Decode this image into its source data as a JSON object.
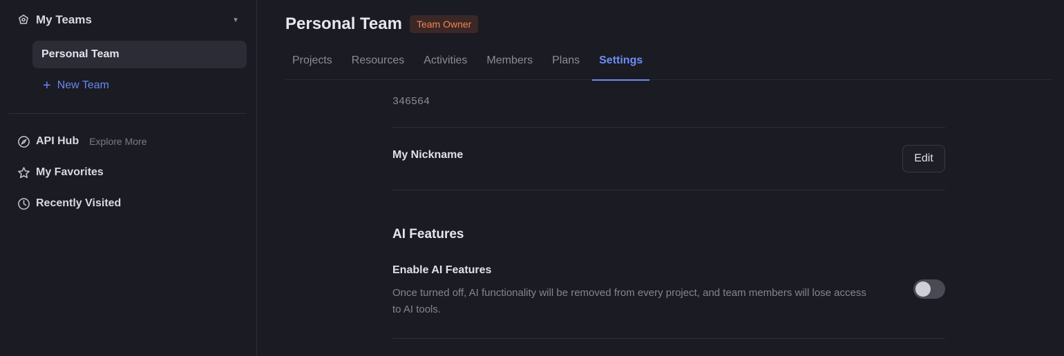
{
  "sidebar": {
    "teams_label": "My Teams",
    "teams": [
      {
        "label": "Personal Team"
      }
    ],
    "new_team_label": "New Team",
    "nav": [
      {
        "label": "API Hub",
        "sub": "Explore More",
        "icon": "compass-icon"
      },
      {
        "label": "My Favorites",
        "icon": "star-icon"
      },
      {
        "label": "Recently Visited",
        "icon": "clock-icon"
      }
    ]
  },
  "header": {
    "title": "Personal Team",
    "badge": "Team Owner"
  },
  "tabs": [
    {
      "label": "Projects"
    },
    {
      "label": "Resources"
    },
    {
      "label": "Activities"
    },
    {
      "label": "Members"
    },
    {
      "label": "Plans"
    },
    {
      "label": "Settings",
      "active": true
    }
  ],
  "settings": {
    "team_id": "346564",
    "nickname_label": "My Nickname",
    "edit_label": "Edit",
    "ai_section_title": "AI Features",
    "ai_toggle_label": "Enable AI Features",
    "ai_toggle_desc": "Once turned off, AI functionality will be removed from every project, and team members will lose access to AI tools.",
    "ai_enabled": false
  },
  "colors": {
    "background": "#1b1b24",
    "accent": "#6e8ef5",
    "badge_text": "#f3844f",
    "badge_bg": "#3a2726"
  }
}
